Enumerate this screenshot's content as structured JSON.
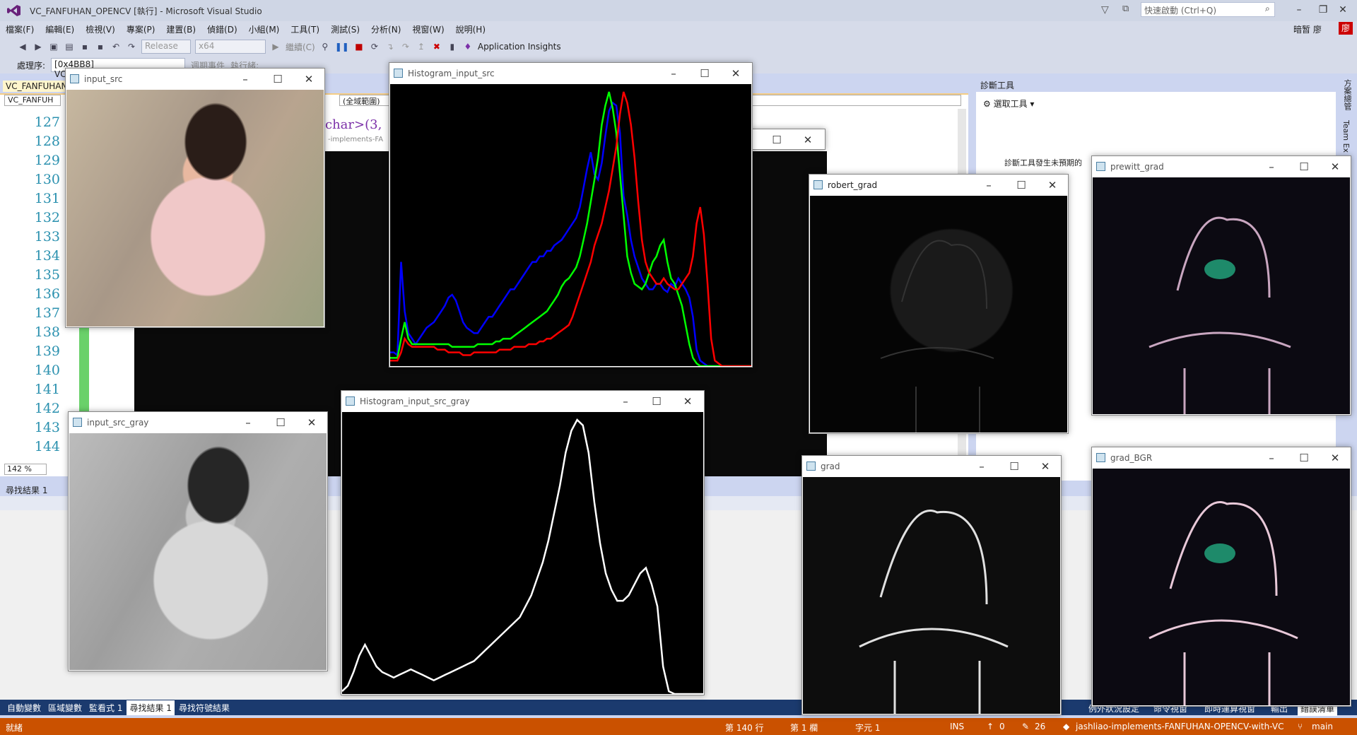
{
  "titlebar": {
    "title": "VC_FANFUHAN_OPENCV [執行] - Microsoft Visual Studio",
    "quick_launch": "快速啟動 (Ctrl+Q)",
    "user": "暗暂 廖"
  },
  "menu": [
    "檔案(F)",
    "編輯(E)",
    "檢視(V)",
    "專案(P)",
    "建置(B)",
    "偵錯(D)",
    "小組(M)",
    "工具(T)",
    "測試(S)",
    "分析(N)",
    "視窗(W)",
    "說明(H)"
  ],
  "toolbar": {
    "config": "Release",
    "platform": "x64",
    "continue": "繼續(C)",
    "app_insights": "Application Insights"
  },
  "toolbar2": {
    "process_label": "處理序:",
    "process_value": "[0x4BB8] VC_FANFUHAN_OPENCV",
    "lifecycle": "週期事件",
    "thread": "執行緒:"
  },
  "editor": {
    "tab": "VC_FANFUHAN_OPENCV",
    "project_combo": "VC_FANFUH",
    "scope": "(全域範圍)",
    "code_fragment": "char>(3,",
    "repo_fragment": "-implements-FA",
    "zoom": "142 %",
    "line_numbers": [
      "127",
      "128",
      "129",
      "130",
      "131",
      "132",
      "133",
      "134",
      "135",
      "136",
      "137",
      "138",
      "139",
      "140",
      "141",
      "142",
      "143",
      "144"
    ]
  },
  "diagnostics": {
    "title": "診斷工具",
    "select_tool": "選取工具",
    "message": "診斷工具發生未預期的"
  },
  "rightrail": {
    "items": [
      "方案總管",
      "Team Ex"
    ]
  },
  "findpanel": {
    "title": "尋找結果 1"
  },
  "bottomtabs": [
    {
      "label": "自動變數"
    },
    {
      "label": "區域變數"
    },
    {
      "label": "監看式 1"
    },
    {
      "label": "尋找結果 1",
      "active": true
    },
    {
      "label": "尋找符號結果"
    }
  ],
  "rightbottomtabs": [
    "例外狀況設定",
    "命令視窗",
    "即時運算視窗",
    "輸出",
    "錯誤清單"
  ],
  "statusbar": {
    "ready": "就緒",
    "line": "第 140 行",
    "col": "第 1 欄",
    "char": "字元 1",
    "ins": "INS",
    "up": "0",
    "edits": "26",
    "repo": "jashliao-implements-FANFUHAN-OPENCV-with-VC",
    "branch": "main"
  },
  "windows": {
    "input_src": {
      "title": "input_src"
    },
    "hist_src": {
      "title": "Histogram_input_src"
    },
    "input_gray": {
      "title": "input_src_gray"
    },
    "hist_gray": {
      "title": "Histogram_input_src_gray"
    },
    "robert": {
      "title": "robert_grad"
    },
    "prewitt": {
      "title": "prewitt_grad"
    },
    "grad": {
      "title": "grad"
    },
    "grad_bgr": {
      "title": "grad_BGR"
    }
  },
  "chart_data": [
    {
      "type": "line",
      "title": "Histogram_input_src",
      "series": [
        {
          "color": "#0000ff",
          "values": [
            5,
            5,
            4,
            38,
            20,
            12,
            10,
            8,
            10,
            12,
            14,
            15,
            16,
            18,
            20,
            22,
            25,
            26,
            24,
            20,
            16,
            14,
            13,
            12,
            12,
            14,
            16,
            18,
            18,
            20,
            22,
            24,
            26,
            28,
            28,
            30,
            32,
            34,
            36,
            38,
            38,
            40,
            40,
            42,
            42,
            44,
            45,
            46,
            48,
            50,
            52,
            54,
            58,
            65,
            72,
            78,
            70,
            68,
            74,
            84,
            93,
            96,
            95,
            85,
            62,
            55,
            46,
            40,
            36,
            32,
            30,
            28,
            28,
            30,
            30,
            28,
            27,
            30,
            29,
            32,
            30,
            28,
            25,
            18,
            6,
            2,
            1,
            0,
            0,
            0,
            0,
            0,
            0,
            0,
            0,
            0,
            0,
            0,
            0,
            0
          ]
        },
        {
          "color": "#00ff00",
          "values": [
            3,
            3,
            3,
            10,
            16,
            10,
            8,
            8,
            8,
            8,
            8,
            8,
            8,
            8,
            8,
            8,
            8,
            7,
            7,
            7,
            7,
            7,
            7,
            7,
            8,
            8,
            8,
            8,
            8,
            9,
            9,
            10,
            10,
            10,
            11,
            12,
            13,
            14,
            15,
            16,
            17,
            18,
            19,
            20,
            22,
            24,
            26,
            29,
            31,
            32,
            34,
            36,
            40,
            46,
            52,
            60,
            68,
            76,
            88,
            95,
            100,
            94,
            85,
            70,
            55,
            40,
            34,
            30,
            29,
            28,
            30,
            34,
            38,
            40,
            44,
            46,
            38,
            32,
            30,
            26,
            22,
            15,
            8,
            3,
            1,
            0,
            0,
            0,
            0,
            0,
            0,
            0,
            0,
            0,
            0,
            0,
            0,
            0,
            0,
            0
          ]
        },
        {
          "color": "#ff0000",
          "values": [
            2,
            2,
            2,
            5,
            10,
            8,
            7,
            7,
            7,
            7,
            7,
            7,
            7,
            6,
            6,
            6,
            5,
            5,
            5,
            5,
            4,
            4,
            4,
            5,
            5,
            5,
            5,
            5,
            5,
            5,
            6,
            6,
            6,
            6,
            7,
            7,
            7,
            7,
            8,
            8,
            8,
            9,
            9,
            10,
            10,
            11,
            12,
            13,
            14,
            15,
            18,
            22,
            26,
            30,
            34,
            38,
            44,
            48,
            52,
            58,
            64,
            72,
            80,
            92,
            100,
            96,
            88,
            76,
            60,
            46,
            38,
            34,
            32,
            30,
            30,
            32,
            30,
            29,
            28,
            28,
            30,
            32,
            34,
            40,
            52,
            58,
            48,
            30,
            10,
            2,
            1,
            0,
            0,
            0,
            0,
            0,
            0,
            0,
            0,
            0
          ]
        }
      ]
    },
    {
      "type": "line",
      "title": "Histogram_input_src_gray",
      "series": [
        {
          "color": "#ffffff",
          "values": [
            1,
            3,
            8,
            14,
            18,
            14,
            10,
            8,
            7,
            6,
            7,
            8,
            9,
            8,
            7,
            6,
            5,
            6,
            7,
            8,
            9,
            10,
            11,
            12,
            14,
            16,
            18,
            20,
            22,
            24,
            26,
            28,
            32,
            36,
            42,
            48,
            56,
            66,
            76,
            88,
            96,
            100,
            98,
            88,
            70,
            55,
            44,
            38,
            34,
            34,
            36,
            40,
            44,
            46,
            40,
            32,
            10,
            1,
            0,
            0,
            0,
            0,
            0,
            0
          ]
        }
      ]
    }
  ]
}
